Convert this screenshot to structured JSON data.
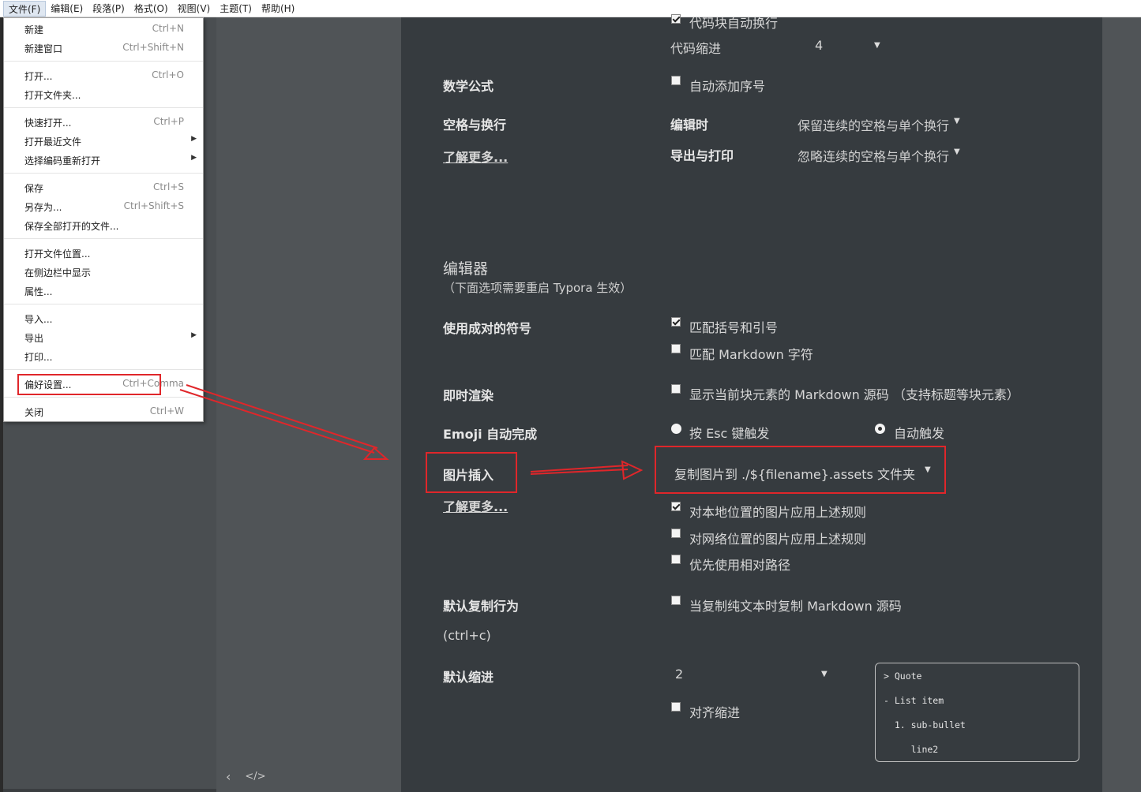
{
  "menubar": {
    "items": [
      "文件(F)",
      "编辑(E)",
      "段落(P)",
      "格式(O)",
      "视图(V)",
      "主题(T)",
      "帮助(H)"
    ]
  },
  "file_menu": {
    "items": [
      {
        "label": "新建",
        "shortcut": "Ctrl+N"
      },
      {
        "label": "新建窗口",
        "shortcut": "Ctrl+Shift+N"
      },
      {
        "label": "打开...",
        "shortcut": "Ctrl+O"
      },
      {
        "label": "打开文件夹...",
        "shortcut": ""
      },
      {
        "label": "快速打开...",
        "shortcut": "Ctrl+P"
      },
      {
        "label": "打开最近文件",
        "shortcut": ""
      },
      {
        "label": "选择编码重新打开",
        "shortcut": ""
      },
      {
        "label": "保存",
        "shortcut": "Ctrl+S"
      },
      {
        "label": "另存为...",
        "shortcut": "Ctrl+Shift+S"
      },
      {
        "label": "保存全部打开的文件...",
        "shortcut": ""
      },
      {
        "label": "打开文件位置...",
        "shortcut": ""
      },
      {
        "label": "在侧边栏中显示",
        "shortcut": ""
      },
      {
        "label": "属性...",
        "shortcut": ""
      },
      {
        "label": "导入...",
        "shortcut": ""
      },
      {
        "label": "导出",
        "shortcut": ""
      },
      {
        "label": "打印...",
        "shortcut": ""
      },
      {
        "label": "偏好设置...",
        "shortcut": "Ctrl+Comma"
      },
      {
        "label": "关闭",
        "shortcut": "Ctrl+W"
      }
    ],
    "submenu_arrow": "▶"
  },
  "settings": {
    "code_wrap_label": "代码块自动换行",
    "code_indent_label": "代码缩进",
    "code_indent_value": "4",
    "math_label": "数学公式",
    "math_autonumber": "自动添加序号",
    "whitespace_label": "空格与换行",
    "learn_more": "了解更多...",
    "editing_label": "编辑时",
    "editing_value": "保留连续的空格与单个换行",
    "export_label": "导出与打印",
    "export_value": "忽略连续的空格与单个换行",
    "editor_section": "编辑器",
    "editor_note": "（下面选项需要重启 Typora 生效）",
    "pairs_label": "使用成对的符号",
    "pairs_brackets": "匹配括号和引号",
    "pairs_markdown": "匹配 Markdown 字符",
    "live_label": "即时渲染",
    "live_option": "显示当前块元素的 Markdown 源码 （支持标题等块元素）",
    "emoji_label": "Emoji 自动完成",
    "emoji_esc": "按 Esc 键触发",
    "emoji_auto": "自动触发",
    "image_label": "图片插入",
    "image_value": "复制图片到 ./${filename}.assets 文件夹",
    "image_local": "对本地位置的图片应用上述规则",
    "image_network": "对网络位置的图片应用上述规则",
    "image_relative": "优先使用相对路径",
    "copy_label": "默认复制行为",
    "copy_shortcut": "(ctrl+c)",
    "copy_option": "当复制纯文本时复制 Markdown 源码",
    "indent_label": "默认缩进",
    "indent_value": "2",
    "align_indent": "对齐缩进",
    "preview": [
      "> Quote",
      "- List item",
      "  1. sub-bullet",
      "     line2"
    ]
  },
  "footer": {
    "back": "‹",
    "code": "</>"
  },
  "colors": {
    "panel": "#363b3f",
    "annotation": "#e0262a"
  }
}
